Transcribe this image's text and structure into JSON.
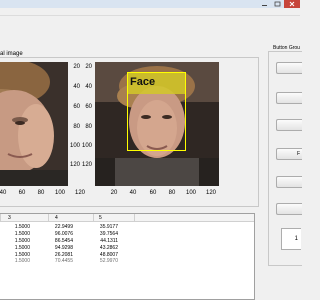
{
  "window": {
    "menu_items": [
      "",
      "",
      "",
      "",
      ""
    ]
  },
  "main_panel": {
    "title": "al image"
  },
  "original_axes": {
    "y_ticks": [
      "20",
      "40",
      "60",
      "80",
      "100",
      "120"
    ],
    "x_ticks": [
      "40",
      "60",
      "80",
      "100",
      "120"
    ]
  },
  "detected_axes": {
    "y_ticks": [
      "20",
      "40",
      "60",
      "80",
      "100",
      "120"
    ],
    "x_ticks": [
      "20",
      "40",
      "60",
      "80",
      "100",
      "120"
    ],
    "detection_label": "Face",
    "box_color": "#ffff00"
  },
  "button_group": {
    "title": "Button Grou",
    "buttons": [
      "",
      "",
      "",
      "F",
      "",
      ""
    ],
    "result_value": "1"
  },
  "table": {
    "headers": [
      "3",
      "4",
      "5"
    ],
    "rows": [
      [
        "1.5000",
        "22.9499",
        "35.9177"
      ],
      [
        "1.5000",
        "96.0076",
        "39.7564"
      ],
      [
        "1.5000",
        "86.5454",
        "44.1311"
      ],
      [
        "1.5000",
        "94.9298",
        "43.2862"
      ],
      [
        "1.5000",
        "26.2081",
        "48.8007"
      ],
      [
        "1.5000",
        "70.4455",
        "52.9970"
      ]
    ]
  }
}
